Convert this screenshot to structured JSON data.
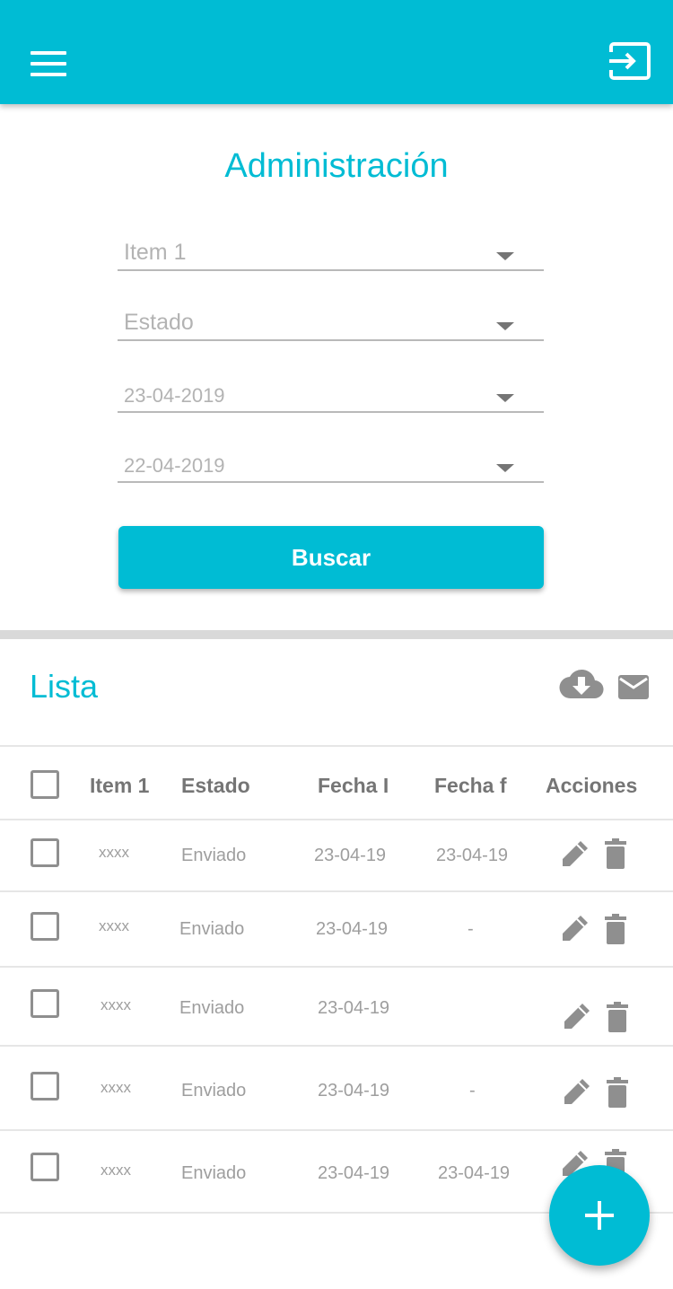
{
  "header": {
    "menu_icon": "hamburger-menu-icon",
    "logout_icon": "logout-icon",
    "color": "#00bcd4"
  },
  "filters": {
    "title": "Administración",
    "item": "Item 1",
    "estado": "Estado",
    "fecha_inicio": "23-04-2019",
    "fecha_fin": "22-04-2019",
    "search_button": "Buscar"
  },
  "list": {
    "title": "Lista",
    "download_icon": "cloud-download-icon",
    "email_icon": "email-icon",
    "columns": [
      "Item 1",
      "Estado",
      "Fecha I",
      "Fecha f",
      "Acciones"
    ],
    "rows": [
      {
        "item": "xxxx",
        "estado": "Enviado",
        "fecha_i": "23-04-19",
        "fecha_f": "23-04-19"
      },
      {
        "item": "xxxx",
        "estado": "Enviado",
        "fecha_i": "23-04-19",
        "fecha_f": "-"
      },
      {
        "item": "xxxx",
        "estado": "Enviado",
        "fecha_i": "23-04-19",
        "fecha_f": ""
      },
      {
        "item": "xxxx",
        "estado": "Enviado",
        "fecha_i": "23-04-19",
        "fecha_f": "-"
      },
      {
        "item": "xxxx",
        "estado": "Enviado",
        "fecha_i": "23-04-19",
        "fecha_f": "23-04-19"
      }
    ]
  },
  "fab": {
    "icon": "add-icon"
  }
}
